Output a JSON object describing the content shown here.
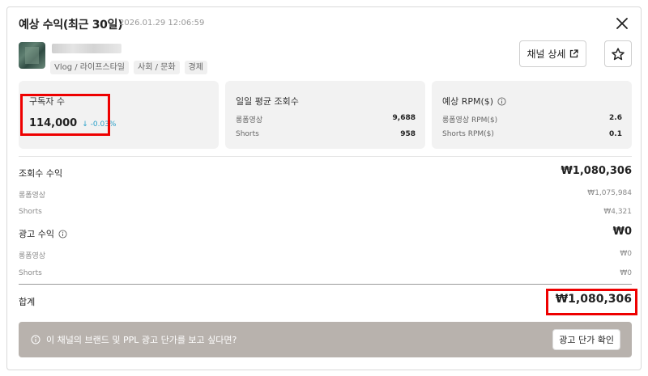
{
  "header": {
    "title": "예상 수익(최근 30일)",
    "timestamp": "2026.01.29 12:06:59"
  },
  "channel": {
    "tags": [
      "Vlog / 라이프스타일",
      "사회 / 문화",
      "경제"
    ],
    "detail_button": "채널 상세"
  },
  "cards": {
    "subscribers": {
      "title": "구독자 수",
      "value": "114,000",
      "delta": "↓ -0.03%",
      "delta_color": "#2aa0c8"
    },
    "daily_views": {
      "title": "일일 평균 조회수",
      "rows": [
        {
          "label": "롱폼영상",
          "value": "9,688"
        },
        {
          "label": "Shorts",
          "value": "958"
        }
      ]
    },
    "rpm": {
      "title": "예상 RPM($)",
      "rows": [
        {
          "label": "롱폼영상 RPM($)",
          "value": "2.6"
        },
        {
          "label": "Shorts RPM($)",
          "value": "0.1"
        }
      ]
    }
  },
  "view_revenue": {
    "label": "조회수 수익",
    "amount": "₩1,080,306",
    "rows": [
      {
        "label": "롱폼영상",
        "value": "₩1,075,984"
      },
      {
        "label": "Shorts",
        "value": "₩4,321"
      }
    ]
  },
  "ad_revenue": {
    "label": "광고 수익",
    "amount": "₩0",
    "rows": [
      {
        "label": "롱폼영상",
        "value": "₩0"
      },
      {
        "label": "Shorts",
        "value": "₩0"
      }
    ]
  },
  "total": {
    "label": "합계",
    "amount": "₩1,080,306"
  },
  "banner": {
    "text": "이 채널의 브랜드 및 PPL 광고 단가를 보고 싶다면?",
    "button": "광고 단가 확인",
    "background": "#b8b2ad"
  },
  "colors": {
    "highlight": "#ee0000"
  },
  "icons": {
    "close": "close-icon",
    "external_link": "external-link-icon",
    "star": "star-icon",
    "info": "info-icon"
  }
}
